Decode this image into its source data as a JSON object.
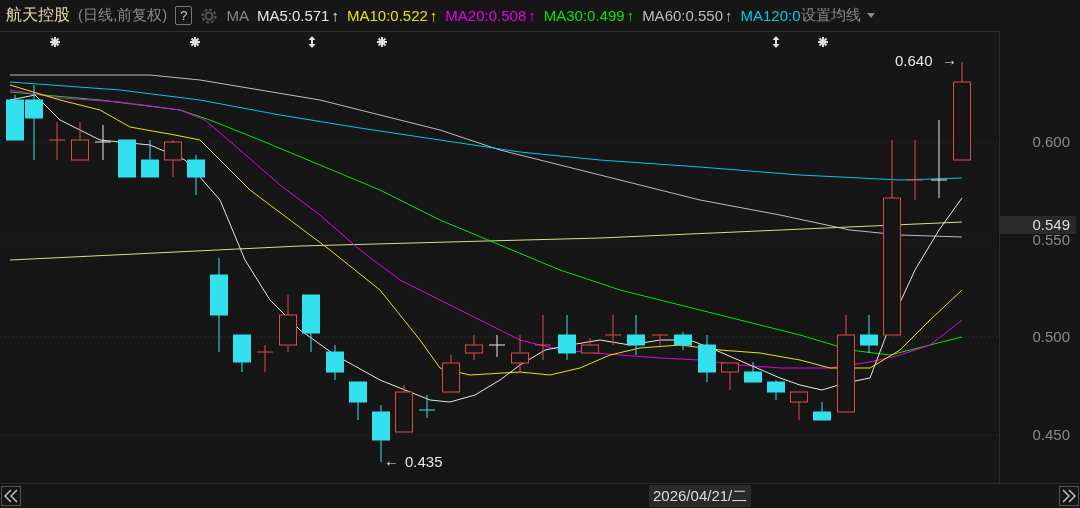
{
  "header": {
    "title": "航天控股",
    "subtitle": "(日线,前复权)",
    "help": "?",
    "ma_label": "MA",
    "settings": "设置均线",
    "averages": [
      {
        "label": "MA5:0.571",
        "arrow": "↑",
        "color": "#e6e6e6"
      },
      {
        "label": "MA10:0.522",
        "arrow": "↑",
        "color": "#e6e600"
      },
      {
        "label": "MA20:0.508",
        "arrow": "↑",
        "color": "#e600e6"
      },
      {
        "label": "MA30:0.499",
        "arrow": "↑",
        "color": "#00e600"
      },
      {
        "label": "MA60:0.550",
        "arrow": "↑",
        "color": "#bcbcbc"
      },
      {
        "label": "MA120:0",
        "color": "#00c8e8"
      }
    ]
  },
  "chart": {
    "high_label": {
      "text": "0.640",
      "arrow": "→"
    },
    "low_label": {
      "arrow": "←",
      "text": "0.435"
    }
  },
  "price_axis": {
    "ticks": [
      "0.600",
      "0.550",
      "0.500",
      "0.450"
    ],
    "current_price": "0.549"
  },
  "time_bar": {
    "date": "2026/04/21/二"
  }
}
